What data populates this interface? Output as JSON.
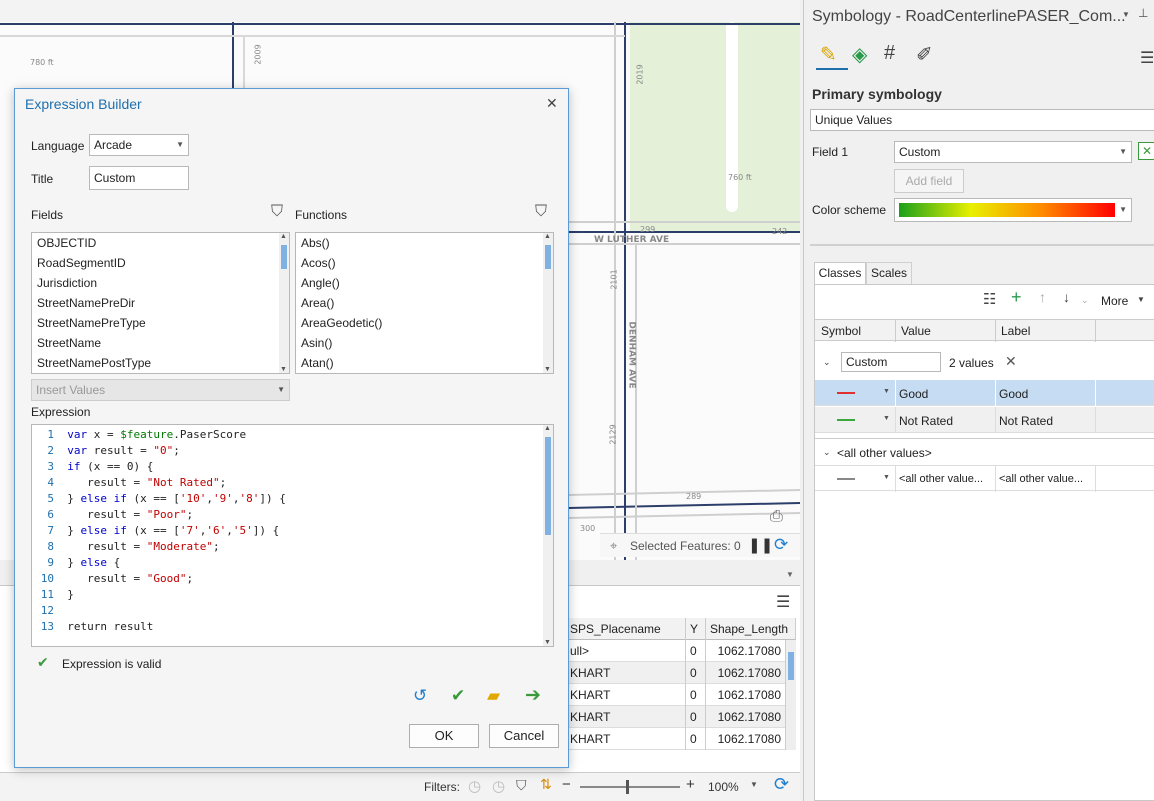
{
  "map": {
    "labels": [
      "780 ft",
      "2009",
      "2019",
      "760 ft",
      "299",
      "242",
      "W LUTHER AVE",
      "2101",
      "DENHAM AVE",
      "2129",
      "289",
      "300"
    ],
    "selected_features": "Selected Features: 0"
  },
  "attribute_table": {
    "columns": [
      "SPS_Placename",
      "Y",
      "Shape_Length"
    ],
    "rows": [
      [
        "ull>",
        "0",
        "1062.17080"
      ],
      [
        "KHART",
        "0",
        "1062.17080"
      ],
      [
        "KHART",
        "0",
        "1062.17080"
      ],
      [
        "KHART",
        "0",
        "1062.17080"
      ],
      [
        "KHART",
        "0",
        "1062.17080"
      ]
    ],
    "filters_label": "Filters:",
    "zoom": "100%"
  },
  "dialog": {
    "title": "Expression Builder",
    "language_label": "Language",
    "language_value": "Arcade",
    "title_label": "Title",
    "title_value": "Custom",
    "fields_label": "Fields",
    "functions_label": "Functions",
    "fields": [
      "OBJECTID",
      "RoadSegmentID",
      "Jurisdiction",
      "StreetNamePreDir",
      "StreetNamePreType",
      "StreetName",
      "StreetNamePostType"
    ],
    "functions": [
      "Abs()",
      "Acos()",
      "Angle()",
      "Area()",
      "AreaGeodetic()",
      "Asin()",
      "Atan()"
    ],
    "insert_values": "Insert Values",
    "expression_label": "Expression",
    "code_lines": [
      {
        "n": "1",
        "text": "var x = $feature.PaserScore"
      },
      {
        "n": "2",
        "text": "var result = \"0\";"
      },
      {
        "n": "3",
        "text": "if (x == 0) {"
      },
      {
        "n": "4",
        "text": "   result = \"Not Rated\";"
      },
      {
        "n": "5",
        "text": "} else if (x == ['10','9','8']) {"
      },
      {
        "n": "6",
        "text": "   result = \"Poor\";"
      },
      {
        "n": "7",
        "text": "} else if (x == ['7','6','5']) {"
      },
      {
        "n": "8",
        "text": "   result = \"Moderate\";"
      },
      {
        "n": "9",
        "text": "} else {"
      },
      {
        "n": "10",
        "text": "   result = \"Good\";"
      },
      {
        "n": "11",
        "text": "}"
      },
      {
        "n": "12",
        "text": ""
      },
      {
        "n": "13",
        "text": "return result"
      }
    ],
    "valid_message": "Expression is valid",
    "ok_label": "OK",
    "cancel_label": "Cancel"
  },
  "symbology": {
    "title": "Symbology - RoadCenterlinePASER_Com...",
    "primary_label": "Primary symbology",
    "primary_value": "Unique Values",
    "field1_label": "Field 1",
    "field1_value": "Custom",
    "add_field": "Add field",
    "color_scheme_label": "Color scheme",
    "tabs": [
      "Classes",
      "Scales"
    ],
    "more_label": "More",
    "columns": [
      "Symbol",
      "Value",
      "Label"
    ],
    "group_value": "Custom",
    "group_count": "2 values",
    "classes": [
      {
        "value": "Good",
        "label": "Good",
        "color": "#e03030"
      },
      {
        "value": "Not Rated",
        "label": "Not Rated",
        "color": "#3aa83a"
      }
    ],
    "other_heading": "<all other values>",
    "other_value": "<all other value...",
    "other_label": "<all other value..."
  },
  "colors": {
    "accent": "#1f6fad",
    "selection": "#c5dcf2",
    "valid": "#3a9a3a"
  }
}
